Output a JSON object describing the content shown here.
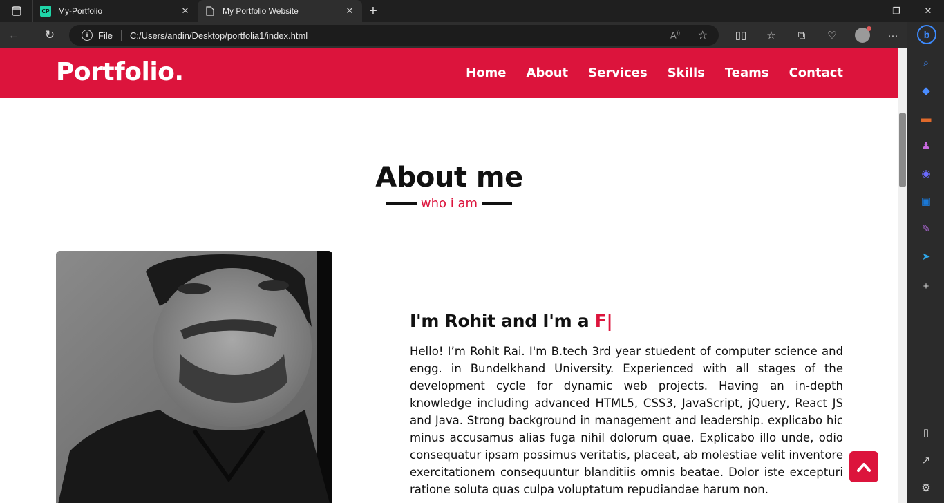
{
  "browser": {
    "tabs": [
      {
        "title": "My-Portfolio",
        "active": false
      },
      {
        "title": "My Portfolio Website",
        "active": true
      }
    ],
    "address": {
      "scheme": "File",
      "url": "C:/Users/andin/Desktop/portfolia1/index.html"
    }
  },
  "page": {
    "logo": "Portfolio.",
    "menu": [
      "Home",
      "About",
      "Services",
      "Skills",
      "Teams",
      "Contact"
    ],
    "section_title": "About me",
    "section_subtitle": "who i am",
    "heading_static": "I'm Rohit and I'm a ",
    "heading_typed": "F|",
    "about_text": "Hello! I’m Rohit Rai. I'm B.tech 3rd year stuedent of computer science and engg. in Bundelkhand University. Experienced with all stages of the development cycle for dynamic web projects. Having an in-depth knowledge including advanced HTML5, CSS3, JavaScript, jQuery, React JS and Java. Strong background in management and leadership. explicabo hic minus accusamus alias fuga nihil dolorum quae. Explicabo illo unde, odio consequatur ipsam possimus veritatis, placeat, ab molestiae velit inventore exercitationem consequuntur blanditiis omnis beatae. Dolor iste excepturi ratione soluta quas culpa voluptatum repudiandae harum non."
  },
  "colors": {
    "accent": "#dc143c"
  }
}
